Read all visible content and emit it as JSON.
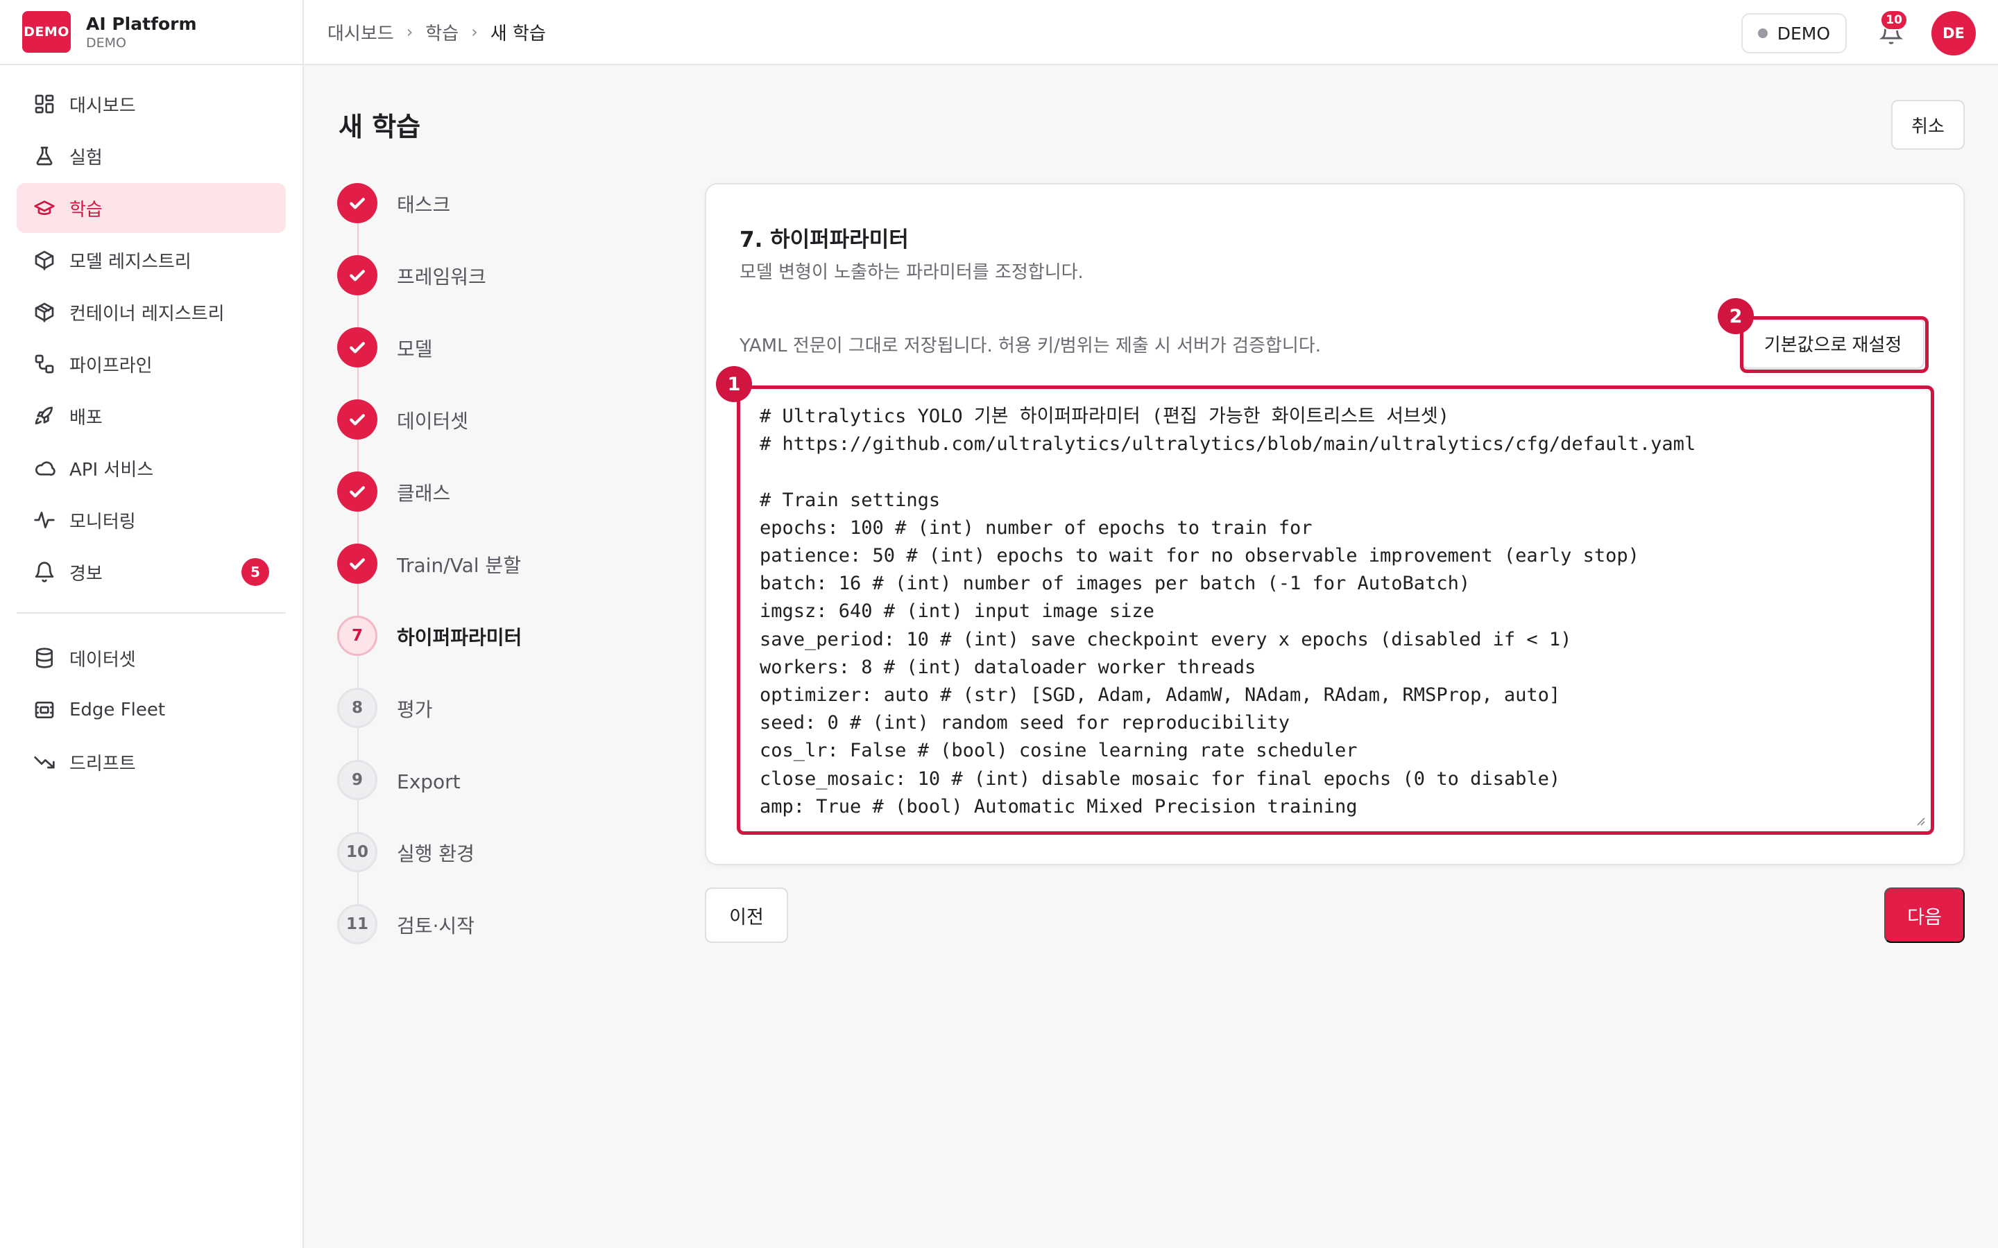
{
  "brand": {
    "logo_text": "DEMO",
    "name": "AI Platform",
    "sub": "DEMO"
  },
  "sidebar": {
    "items": [
      {
        "label": "대시보드",
        "icon": "dashboard-icon"
      },
      {
        "label": "실험",
        "icon": "flask-icon"
      },
      {
        "label": "학습",
        "icon": "graduation-cap-icon",
        "active": true
      },
      {
        "label": "모델 레지스트리",
        "icon": "cube-icon"
      },
      {
        "label": "컨테이너 레지스트리",
        "icon": "package-icon"
      },
      {
        "label": "파이프라인",
        "icon": "workflow-icon"
      },
      {
        "label": "배포",
        "icon": "rocket-icon"
      },
      {
        "label": "API 서비스",
        "icon": "cloud-icon"
      },
      {
        "label": "모니터링",
        "icon": "activity-icon"
      },
      {
        "label": "경보",
        "icon": "bell-icon",
        "badge": "5"
      }
    ],
    "items2": [
      {
        "label": "데이터셋",
        "icon": "database-icon"
      },
      {
        "label": "Edge Fleet",
        "icon": "chip-icon"
      },
      {
        "label": "드리프트",
        "icon": "trend-down-icon"
      }
    ]
  },
  "breadcrumb": [
    "대시보드",
    "학습",
    "새 학습"
  ],
  "topbar": {
    "env_label": "DEMO",
    "notif_count": "10",
    "avatar_initials": "DE"
  },
  "page": {
    "title": "새 학습",
    "cancel_label": "취소"
  },
  "steps": [
    {
      "label": "태스크",
      "state": "done"
    },
    {
      "label": "프레임워크",
      "state": "done"
    },
    {
      "label": "모델",
      "state": "done"
    },
    {
      "label": "데이터셋",
      "state": "done"
    },
    {
      "label": "클래스",
      "state": "done"
    },
    {
      "label": "Train/Val 분할",
      "state": "done"
    },
    {
      "label": "하이퍼파라미터",
      "state": "current",
      "num": "7"
    },
    {
      "label": "평가",
      "state": "todo",
      "num": "8"
    },
    {
      "label": "Export",
      "state": "todo",
      "num": "9"
    },
    {
      "label": "실행 환경",
      "state": "todo",
      "num": "10"
    },
    {
      "label": "검토·시작",
      "state": "todo",
      "num": "11"
    }
  ],
  "card": {
    "title": "7. 하이퍼파라미터",
    "subtitle": "모델 변형이 노출하는 파라미터를 조정합니다.",
    "note": "YAML 전문이 그대로 저장됩니다. 허용 키/범위는 제출 시 서버가 검증합니다.",
    "reset_label": "기본값으로 재설정",
    "yaml": "# Ultralytics YOLO 기본 하이퍼파라미터 (편집 가능한 화이트리스트 서브셋)\n# https://github.com/ultralytics/ultralytics/blob/main/ultralytics/cfg/default.yaml\n\n# Train settings\nepochs: 100 # (int) number of epochs to train for\npatience: 50 # (int) epochs to wait for no observable improvement (early stop)\nbatch: 16 # (int) number of images per batch (-1 for AutoBatch)\nimgsz: 640 # (int) input image size\nsave_period: 10 # (int) save checkpoint every x epochs (disabled if < 1)\nworkers: 8 # (int) dataloader worker threads\noptimizer: auto # (str) [SGD, Adam, AdamW, NAdam, RAdam, RMSProp, auto]\nseed: 0 # (int) random seed for reproducibility\ncos_lr: False # (bool) cosine learning rate scheduler\nclose_mosaic: 10 # (int) disable mosaic for final epochs (0 to disable)\namp: True # (bool) Automatic Mixed Precision training",
    "marker1": "1",
    "marker2": "2"
  },
  "footer": {
    "prev_label": "이전",
    "next_label": "다음"
  },
  "colors": {
    "accent": "#e11d48",
    "highlight": "#d11440",
    "accent_soft": "#fde4e9"
  }
}
